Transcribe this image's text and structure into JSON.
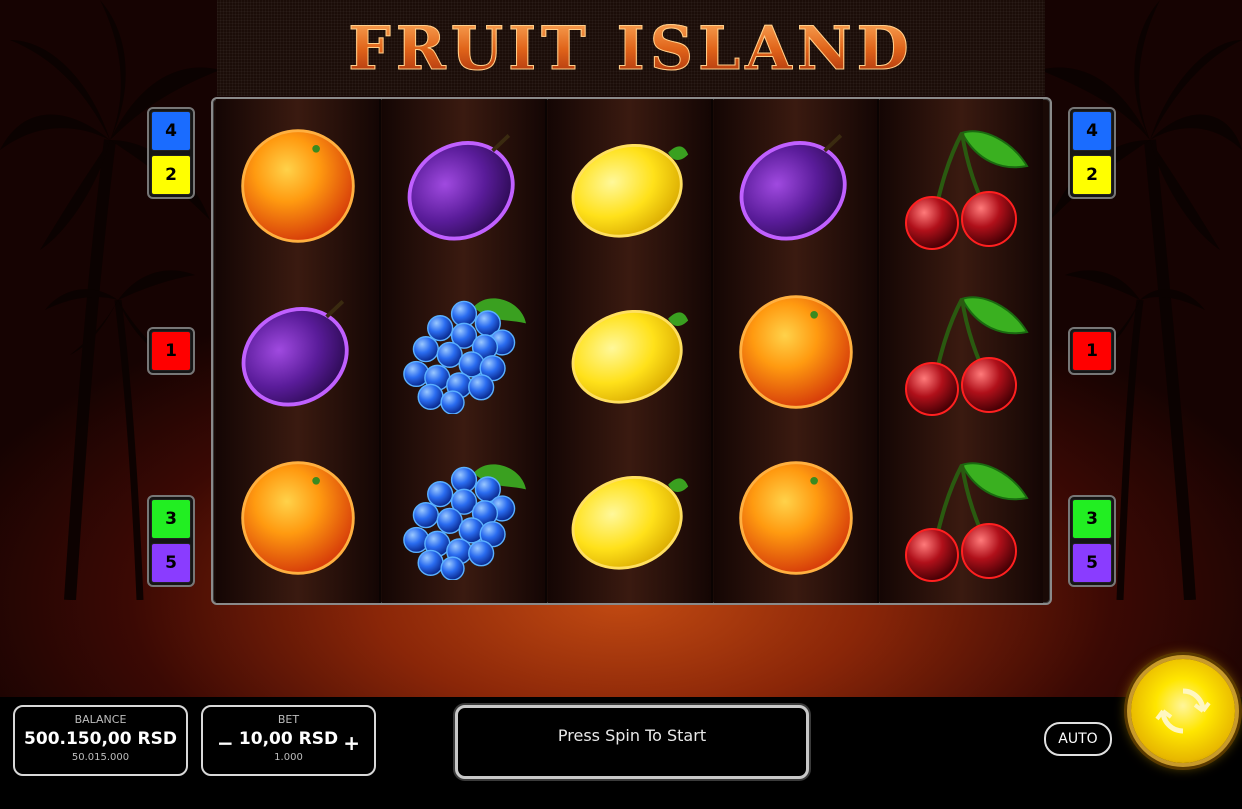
{
  "title": "FRUIT ISLAND",
  "reels": [
    [
      "orange-icon",
      "plum-icon",
      "orange-icon"
    ],
    [
      "plum-icon",
      "grapes-icon",
      "grapes-icon"
    ],
    [
      "lemon-icon",
      "lemon-icon",
      "lemon-icon"
    ],
    [
      "plum-icon",
      "orange-icon",
      "orange-icon"
    ],
    [
      "cherries-icon",
      "cherries-icon",
      "cherries-icon"
    ]
  ],
  "paylines": {
    "left": [
      {
        "label": "4",
        "color": "#1a6cff"
      },
      {
        "label": "2",
        "color": "#ffff00"
      },
      {
        "label": "1",
        "color": "#ff0000"
      },
      {
        "label": "3",
        "color": "#22ee22"
      },
      {
        "label": "5",
        "color": "#8a3cff"
      }
    ],
    "right": [
      {
        "label": "4",
        "color": "#1a6cff"
      },
      {
        "label": "2",
        "color": "#ffff00"
      },
      {
        "label": "1",
        "color": "#ff0000"
      },
      {
        "label": "3",
        "color": "#22ee22"
      },
      {
        "label": "5",
        "color": "#8a3cff"
      }
    ]
  },
  "balance": {
    "label": "BALANCE",
    "value": "500.150,00 RSD",
    "sub": "50.015.000"
  },
  "bet": {
    "label": "BET",
    "value": "10,00 RSD",
    "sub": "1.000",
    "minus": "−",
    "plus": "+"
  },
  "message": "Press Spin To Start",
  "auto_label": "AUTO",
  "spin_icon": "refresh-icon"
}
